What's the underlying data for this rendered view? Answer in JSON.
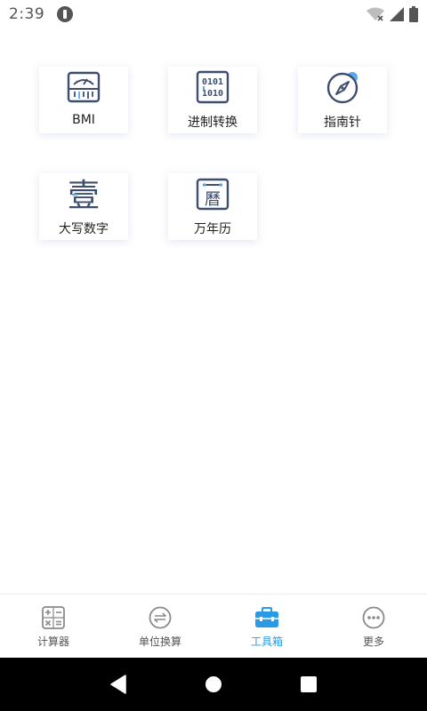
{
  "status_bar": {
    "time": "2:39"
  },
  "tools": [
    {
      "label": "BMI",
      "icon": "scale-icon"
    },
    {
      "label": "进制转换",
      "icon": "binary-icon"
    },
    {
      "label": "指南针",
      "icon": "compass-icon"
    },
    {
      "label": "大写数字",
      "icon": "chinese-numeral-icon"
    },
    {
      "label": "万年历",
      "icon": "calendar-icon"
    }
  ],
  "chinese_numeral_glyph": "壹",
  "calendar_glyph": "曆",
  "tabs": [
    {
      "label": "计算器",
      "icon": "calculator-icon",
      "active": false
    },
    {
      "label": "单位换算",
      "icon": "unit-convert-icon",
      "active": false
    },
    {
      "label": "工具箱",
      "icon": "toolbox-icon",
      "active": true
    },
    {
      "label": "更多",
      "icon": "more-icon",
      "active": false
    }
  ],
  "colors": {
    "accent": "#2b9ae6",
    "icon_dark": "#3e4e6e",
    "tab_inactive": "#555555"
  }
}
